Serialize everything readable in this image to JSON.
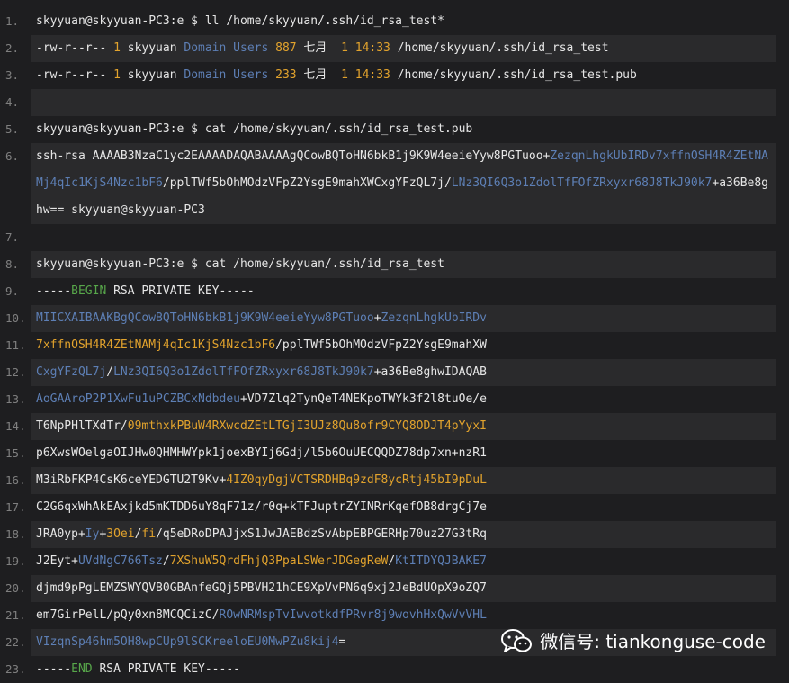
{
  "lines": [
    {
      "n": "1.",
      "shade": false,
      "segs": [
        {
          "t": "skyyuan@skyyuan-PC3:e $ ll /home/skyyuan/.ssh/id_rsa_test*",
          "c": "w"
        }
      ]
    },
    {
      "n": "2.",
      "shade": true,
      "segs": [
        {
          "t": "-rw-r--r-- ",
          "c": "w"
        },
        {
          "t": "1",
          "c": "orange"
        },
        {
          "t": " skyyuan ",
          "c": "w"
        },
        {
          "t": "Domain Users",
          "c": "blue"
        },
        {
          "t": " ",
          "c": "w"
        },
        {
          "t": "887",
          "c": "orange"
        },
        {
          "t": " 七月  ",
          "c": "w"
        },
        {
          "t": "1 14:33",
          "c": "orange"
        },
        {
          "t": " /home/skyyuan/.ssh/id_rsa_test",
          "c": "w"
        }
      ]
    },
    {
      "n": "3.",
      "shade": false,
      "segs": [
        {
          "t": "-rw-r--r-- ",
          "c": "w"
        },
        {
          "t": "1",
          "c": "orange"
        },
        {
          "t": " skyyuan ",
          "c": "w"
        },
        {
          "t": "Domain Users",
          "c": "blue"
        },
        {
          "t": " ",
          "c": "w"
        },
        {
          "t": "233",
          "c": "orange"
        },
        {
          "t": " 七月  ",
          "c": "w"
        },
        {
          "t": "1 14:33",
          "c": "orange"
        },
        {
          "t": " /home/skyyuan/.ssh/id_rsa_test.pub",
          "c": "w"
        }
      ]
    },
    {
      "n": "4.",
      "shade": true,
      "segs": [
        {
          "t": " ",
          "c": "w"
        }
      ]
    },
    {
      "n": "5.",
      "shade": false,
      "segs": [
        {
          "t": "skyyuan@skyyuan-PC3:e $ cat /home/skyyuan/.ssh/id_rsa_test.pub",
          "c": "w"
        }
      ]
    },
    {
      "n": "6.",
      "shade": true,
      "multi": true,
      "segs": [
        {
          "t": "ssh-rsa AAAAB3NzaC1yc2EAAAADAQABAAAAgQCowBQToHN6bkB1j9K9W4eeieYyw8PGTuoo+",
          "c": "w"
        },
        {
          "t": "ZezqnLhgkUbIRDv7xffnOSH4R4ZEtNAMj4qIc1KjS4Nzc1bF6",
          "c": "blue"
        },
        {
          "t": "/pplTWf5bOhMOdzVFpZ2YsgE9mahXWCxgYFzQL7j/",
          "c": "w"
        },
        {
          "t": "LNz3QI6Q3o1ZdolTfFOfZRxyxr68J8TkJ90k7",
          "c": "blue"
        },
        {
          "t": "+a36Be8ghw== skyyuan@skyyuan-PC3",
          "c": "w"
        }
      ]
    },
    {
      "n": "7.",
      "shade": false,
      "segs": [
        {
          "t": " ",
          "c": "w"
        }
      ]
    },
    {
      "n": "8.",
      "shade": true,
      "segs": [
        {
          "t": "skyyuan@skyyuan-PC3:e $ cat /home/skyyuan/.ssh/id_rsa_test",
          "c": "w"
        }
      ]
    },
    {
      "n": "9.",
      "shade": false,
      "segs": [
        {
          "t": "-----",
          "c": "w"
        },
        {
          "t": "BEGIN",
          "c": "green"
        },
        {
          "t": " RSA PRIVATE KEY-----",
          "c": "w"
        }
      ]
    },
    {
      "n": "10.",
      "shade": true,
      "segs": [
        {
          "t": "MIICXAIBAAKBgQCowBQToHN6bkB1j9K9W4eeieYyw8PGTuoo",
          "c": "blue"
        },
        {
          "t": "+",
          "c": "w"
        },
        {
          "t": "ZezqnLhgkUbIRDv",
          "c": "blue"
        }
      ]
    },
    {
      "n": "11.",
      "shade": false,
      "segs": [
        {
          "t": "7xffnOSH4R4ZEtNAMj4qIc1KjS4Nzc1bF6",
          "c": "orange"
        },
        {
          "t": "/pplTWf5bOhMOdzVFpZ2YsgE9mahXW",
          "c": "w"
        }
      ]
    },
    {
      "n": "12.",
      "shade": true,
      "segs": [
        {
          "t": "CxgYFzQL7j",
          "c": "blue"
        },
        {
          "t": "/",
          "c": "w"
        },
        {
          "t": "LNz3QI6Q3o1ZdolTfFOfZRxyxr68J8TkJ90k7",
          "c": "blue"
        },
        {
          "t": "+a36Be8ghwIDAQAB",
          "c": "w"
        }
      ]
    },
    {
      "n": "13.",
      "shade": false,
      "segs": [
        {
          "t": "AoGAAroP2P1XwFu1uPCZBCxNdbdeu",
          "c": "blue"
        },
        {
          "t": "+VD7Zlq2TynQeT4NEKpoTWYk3f2l8tuOe/e",
          "c": "w"
        }
      ]
    },
    {
      "n": "14.",
      "shade": true,
      "segs": [
        {
          "t": "T6NpPHlTXdTr/",
          "c": "w"
        },
        {
          "t": "09mthxkPBuW4RXwcdZEtLTGjI3UJz8Qu8ofr9CYQ8ODJT4pYyxI",
          "c": "orange"
        }
      ]
    },
    {
      "n": "15.",
      "shade": false,
      "segs": [
        {
          "t": "p6XwsWOelgaOIJHw0QHMHWYpk1joexBYIj6Gdj/l5b6OuUECQQDZ78dp7xn+nzR1",
          "c": "w"
        }
      ]
    },
    {
      "n": "16.",
      "shade": true,
      "segs": [
        {
          "t": "M3iRbFKP4CsK6ceYEDGTU2T9Kv+",
          "c": "w"
        },
        {
          "t": "4IZ0qyDgjVCTSRDHBq9zdF8ycRtj45bI9pDuL",
          "c": "orange"
        }
      ]
    },
    {
      "n": "17.",
      "shade": false,
      "segs": [
        {
          "t": "C2G6qxWhAkEAxjkd5mKTDD6uY8qF71z/r0q+kTFJuptrZYINRrKqefOB8drgCj7e",
          "c": "w"
        }
      ]
    },
    {
      "n": "18.",
      "shade": true,
      "segs": [
        {
          "t": "JRA0yp+",
          "c": "w"
        },
        {
          "t": "Iy",
          "c": "blue"
        },
        {
          "t": "+",
          "c": "w"
        },
        {
          "t": "3Oei",
          "c": "orange"
        },
        {
          "t": "/",
          "c": "w"
        },
        {
          "t": "fi",
          "c": "orange"
        },
        {
          "t": "/q5eDRoDPAJjxS1JwJAEBdzSvAbpEBPGERHp70uz27G3tRq",
          "c": "w"
        }
      ]
    },
    {
      "n": "19.",
      "shade": false,
      "segs": [
        {
          "t": "J2Eyt+",
          "c": "w"
        },
        {
          "t": "UVdNgC766Tsz",
          "c": "blue"
        },
        {
          "t": "/",
          "c": "w"
        },
        {
          "t": "7XShuW5QrdFhjQ3PpaLSWerJDGegReW",
          "c": "orange"
        },
        {
          "t": "/",
          "c": "w"
        },
        {
          "t": "KtITDYQJBAKE7",
          "c": "blue"
        }
      ]
    },
    {
      "n": "20.",
      "shade": true,
      "segs": [
        {
          "t": "djmd9pPgLEMZSWYQVB0GBAnfeGQj5PBVH21hCE9XpVvPN6q9xj2JeBdUOpX9oZQ7",
          "c": "w"
        }
      ]
    },
    {
      "n": "21.",
      "shade": false,
      "segs": [
        {
          "t": "em7GirPelL/pQy0xn8MCQCizC/",
          "c": "w"
        },
        {
          "t": "ROwNRMspTvIwvotkdfPRvr8j9wovhHxQwVvVHL",
          "c": "blue"
        }
      ]
    },
    {
      "n": "22.",
      "shade": true,
      "segs": [
        {
          "t": "VIzqnSp46hm5OH8wpCUp9lSCKreeloEU0MwPZu8kij4",
          "c": "blue"
        },
        {
          "t": "=",
          "c": "w"
        }
      ]
    },
    {
      "n": "23.",
      "shade": false,
      "segs": [
        {
          "t": "-----",
          "c": "w"
        },
        {
          "t": "END",
          "c": "green"
        },
        {
          "t": " RSA PRIVATE KEY-----",
          "c": "w"
        }
      ]
    }
  ],
  "watermark": {
    "text": "微信号: tiankonguse-code",
    "icon": "wechat-icon"
  },
  "colors": {
    "background": "#1e1e20",
    "shade": "#2a2a2c",
    "text": "#e6e6e6",
    "blue": "#5d7fb5",
    "orange": "#e2a32d",
    "green": "#57a64a",
    "line_number": "#7f7f7f"
  }
}
